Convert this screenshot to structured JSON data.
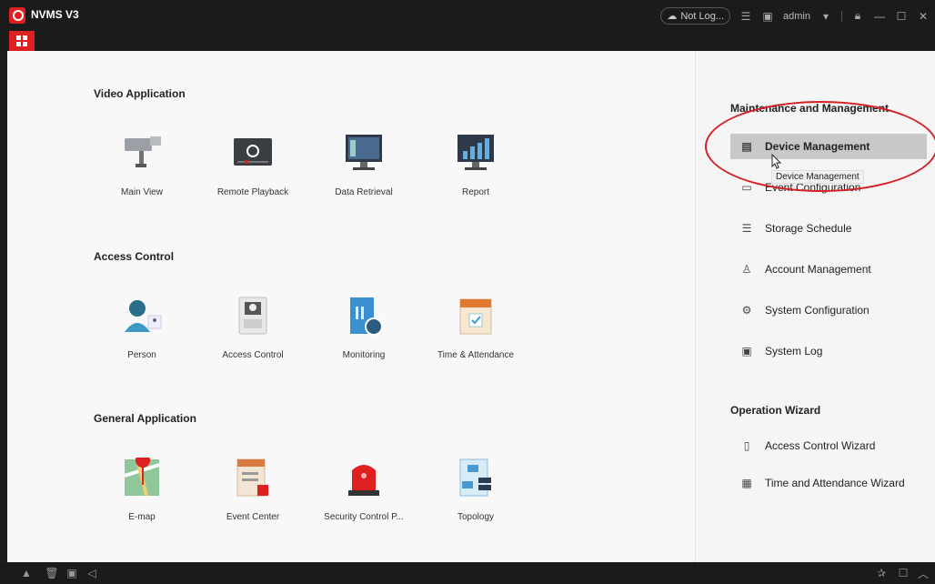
{
  "titlebar": {
    "app_title": "NVMS V3",
    "cloud_status": "Not Log...",
    "user": "admin"
  },
  "left": {
    "sections": [
      {
        "title": "Video Application",
        "tiles": [
          {
            "label": "Main View",
            "icon": "camera-icon"
          },
          {
            "label": "Remote Playback",
            "icon": "playback-icon"
          },
          {
            "label": "Data Retrieval",
            "icon": "monitor-icon"
          },
          {
            "label": "Report",
            "icon": "report-chart-icon"
          }
        ]
      },
      {
        "title": "Access Control",
        "tiles": [
          {
            "label": "Person",
            "icon": "person-icon"
          },
          {
            "label": "Access Control",
            "icon": "keypad-icon"
          },
          {
            "label": "Monitoring",
            "icon": "door-monitor-icon"
          },
          {
            "label": "Time & Attendance",
            "icon": "calendar-icon"
          }
        ]
      },
      {
        "title": "General Application",
        "tiles": [
          {
            "label": "E-map",
            "icon": "map-icon"
          },
          {
            "label": "Event Center",
            "icon": "event-icon"
          },
          {
            "label": "Security Control P...",
            "icon": "alarm-light-icon"
          },
          {
            "label": "Topology",
            "icon": "topology-icon"
          }
        ]
      }
    ]
  },
  "right": {
    "maintenance_title": "Maintenance and Management",
    "maintenance_items": [
      {
        "label": "Device Management",
        "icon": "device-icon"
      },
      {
        "label": "Event Configuration",
        "icon": "event-config-icon"
      },
      {
        "label": "Storage Schedule",
        "icon": "storage-icon"
      },
      {
        "label": "Account Management",
        "icon": "user-icon"
      },
      {
        "label": "System Configuration",
        "icon": "gear-icon"
      },
      {
        "label": "System Log",
        "icon": "log-icon"
      }
    ],
    "wizard_title": "Operation Wizard",
    "wizard_items": [
      {
        "label": "Access Control Wizard",
        "icon": "wizard-door-icon"
      },
      {
        "label": "Time and Attendance Wizard",
        "icon": "wizard-calendar-icon"
      }
    ]
  },
  "tooltip": "Device Management",
  "colors": {
    "accent": "#e02020",
    "annotation": "#d61f26",
    "active_bg": "#c8c8c8"
  }
}
